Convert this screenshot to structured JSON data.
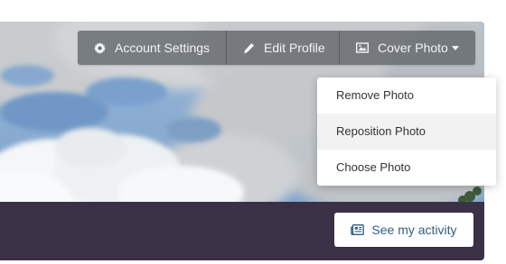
{
  "cover": {
    "toolbar": {
      "account_settings_label": "Account Settings",
      "edit_profile_label": "Edit Profile",
      "cover_photo_label": "Cover Photo"
    },
    "dropdown": {
      "items": [
        {
          "label": "Remove Photo"
        },
        {
          "label": "Reposition Photo",
          "state": "hover"
        },
        {
          "label": "Choose Photo"
        }
      ]
    }
  },
  "profile_bar": {
    "activity_label": "See my activity"
  },
  "colors": {
    "profile_bar": "#3a3147",
    "toolbar_text": "#f4f4f4",
    "activity_text": "#2f5e86",
    "sky": "#7fa6cf"
  },
  "icons": {
    "account_settings": "gear-icon",
    "edit_profile": "pencil-icon",
    "cover_photo": "image-icon",
    "caret": "caret-down-icon",
    "activity": "newspaper-icon"
  }
}
